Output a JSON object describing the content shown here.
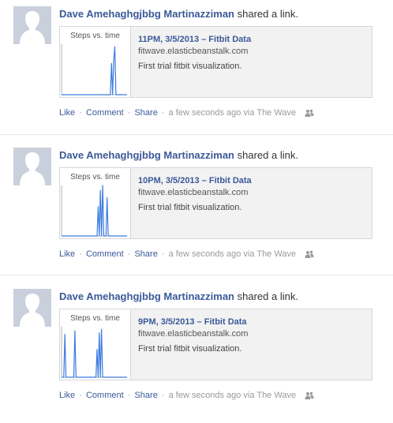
{
  "colors": {
    "link": "#3b5998",
    "meta_text": "#999999",
    "card_bg": "#f2f2f2",
    "chart_line": "#3b7be0"
  },
  "stories": [
    {
      "author": "Dave Amehaghgjbbg Martinazziman",
      "verb": "shared a link.",
      "link_title": "11PM, 3/5/2013 – Fitbit Data",
      "domain": "fitwave.elasticbeanstalk.com",
      "description": "First trial fitbit visualization.",
      "actions": {
        "like": "Like",
        "comment": "Comment",
        "share": "Share",
        "sep": "·"
      },
      "time": "a few seconds ago via",
      "app": "The Wave",
      "privacy_icon": "friends-icon",
      "chart_data": {
        "type": "line",
        "title": "Steps vs. time",
        "x": [
          0,
          1,
          2,
          3,
          4,
          5,
          6,
          7,
          8,
          9,
          10,
          11,
          12,
          13,
          14,
          15,
          16,
          17,
          18,
          19,
          20,
          21,
          22,
          23,
          24,
          25,
          26,
          27,
          28,
          29,
          30,
          31,
          32,
          33,
          34,
          35,
          36,
          37,
          38,
          39,
          40,
          41,
          42,
          43,
          44,
          45,
          46,
          47,
          48,
          49,
          50,
          51,
          52,
          53,
          54,
          55,
          56,
          57,
          58,
          59
        ],
        "values": [
          0,
          0,
          0,
          0,
          0,
          0,
          0,
          0,
          0,
          0,
          0,
          0,
          0,
          0,
          0,
          0,
          0,
          0,
          0,
          0,
          0,
          0,
          0,
          0,
          0,
          0,
          0,
          0,
          0,
          0,
          0,
          0,
          0,
          0,
          0,
          0,
          0,
          0,
          0,
          0,
          0,
          0,
          0,
          0,
          0,
          62,
          0,
          68,
          95,
          0,
          0,
          0,
          0,
          0,
          0,
          0,
          0,
          0,
          0,
          0
        ],
        "ylim": [
          0,
          100
        ],
        "grid": false
      }
    },
    {
      "author": "Dave Amehaghgjbbg Martinazziman",
      "verb": "shared a link.",
      "link_title": "10PM, 3/5/2013 – Fitbit Data",
      "domain": "fitwave.elasticbeanstalk.com",
      "description": "First trial fitbit visualization.",
      "actions": {
        "like": "Like",
        "comment": "Comment",
        "share": "Share",
        "sep": "·"
      },
      "time": "a few seconds ago via",
      "app": "The Wave",
      "privacy_icon": "friends-icon",
      "chart_data": {
        "type": "line",
        "title": "Steps vs. time",
        "x": [
          0,
          1,
          2,
          3,
          4,
          5,
          6,
          7,
          8,
          9,
          10,
          11,
          12,
          13,
          14,
          15,
          16,
          17,
          18,
          19,
          20,
          21,
          22,
          23,
          24,
          25,
          26,
          27,
          28,
          29,
          30,
          31,
          32,
          33,
          34,
          35,
          36,
          37,
          38,
          39,
          40,
          41,
          42,
          43,
          44,
          45,
          46,
          47,
          48,
          49,
          50,
          51,
          52,
          53,
          54,
          55,
          56,
          57,
          58,
          59
        ],
        "values": [
          0,
          0,
          0,
          0,
          0,
          0,
          0,
          0,
          0,
          0,
          0,
          0,
          0,
          0,
          0,
          0,
          0,
          0,
          0,
          0,
          0,
          0,
          0,
          0,
          0,
          0,
          0,
          0,
          0,
          0,
          0,
          0,
          0,
          0,
          0,
          0,
          0,
          0,
          0,
          0,
          0,
          0,
          0,
          0,
          0,
          0,
          0,
          0,
          0,
          0,
          0,
          0,
          0,
          0,
          0,
          0,
          0,
          0,
          0,
          0
        ],
        "series_override": "spikes",
        "spikes": [
          [
            33,
            58
          ],
          [
            34,
            0
          ],
          [
            35,
            90
          ],
          [
            36,
            0
          ],
          [
            37,
            100
          ],
          [
            38,
            0
          ],
          [
            41,
            76
          ],
          [
            42,
            0
          ]
        ],
        "ylim": [
          0,
          100
        ],
        "grid": false
      }
    },
    {
      "author": "Dave Amehaghgjbbg Martinazziman",
      "verb": "shared a link.",
      "link_title": "9PM, 3/5/2013 – Fitbit Data",
      "domain": "fitwave.elasticbeanstalk.com",
      "description": "First trial fitbit visualization.",
      "actions": {
        "like": "Like",
        "comment": "Comment",
        "share": "Share",
        "sep": "·"
      },
      "time": "a few seconds ago via",
      "app": "The Wave",
      "privacy_icon": "friends-icon",
      "chart_data": {
        "type": "line",
        "title": "Steps vs. time",
        "x": [
          0,
          1,
          2,
          3,
          4,
          5,
          6,
          7,
          8,
          9,
          10,
          11,
          12,
          13,
          14,
          15,
          16,
          17,
          18,
          19,
          20,
          21,
          22,
          23,
          24,
          25,
          26,
          27,
          28,
          29,
          30,
          31,
          32,
          33,
          34,
          35,
          36,
          37,
          38,
          39,
          40,
          41,
          42,
          43,
          44,
          45,
          46,
          47,
          48,
          49,
          50,
          51,
          52,
          53,
          54,
          55,
          56,
          57,
          58,
          59
        ],
        "values": [
          0,
          0,
          0,
          0,
          0,
          0,
          0,
          0,
          0,
          0,
          0,
          0,
          0,
          0,
          0,
          0,
          0,
          0,
          0,
          0,
          0,
          0,
          0,
          0,
          0,
          0,
          0,
          0,
          0,
          0,
          0,
          0,
          0,
          0,
          0,
          0,
          0,
          0,
          0,
          0,
          0,
          0,
          0,
          0,
          0,
          0,
          0,
          0,
          0,
          0,
          0,
          0,
          0,
          0,
          0,
          0,
          0,
          0,
          0,
          0
        ],
        "series_override": "spikes",
        "spikes": [
          [
            3,
            85
          ],
          [
            4,
            0
          ],
          [
            12,
            92
          ],
          [
            13,
            0
          ],
          [
            32,
            55
          ],
          [
            33,
            0
          ],
          [
            34,
            88
          ],
          [
            35,
            0
          ],
          [
            36,
            95
          ],
          [
            37,
            0
          ]
        ],
        "ylim": [
          0,
          100
        ],
        "grid": false
      }
    }
  ]
}
